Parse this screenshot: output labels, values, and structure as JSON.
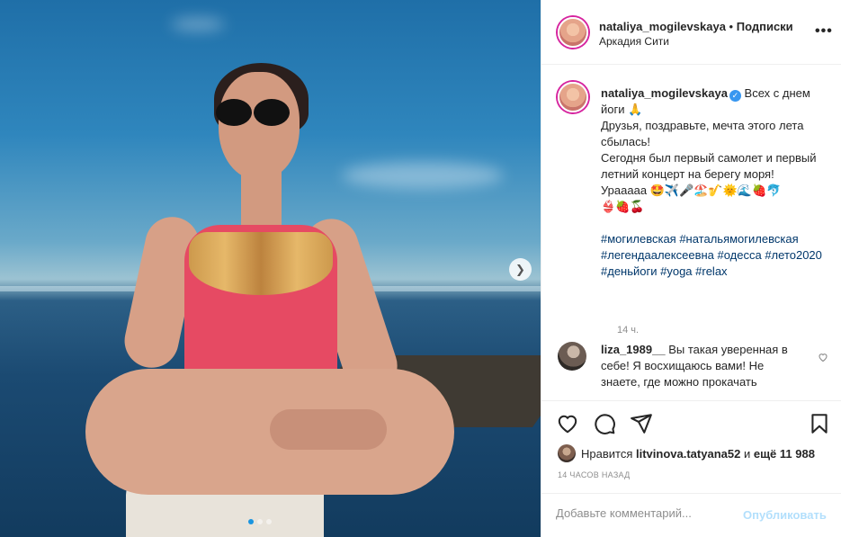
{
  "post": {
    "username": "nataliya_mogilevskaya",
    "separator": "•",
    "follow_label": "Подписки",
    "location": "Аркадия Сити",
    "more_icon": "more-options-icon"
  },
  "caption": {
    "username": "nataliya_mogilevskaya",
    "verified_mark": "✓",
    "line1": "Всех с днем йоги 🙏",
    "line2": "Друзья, поздравьте, мечта этого лета сбылась!",
    "line3": "Сегодня был первый самолет и первый летний концерт на берегу моря!",
    "line4": "Урааааа 🤩✈️🎤🏖️🎷🌞🌊🍓🐬",
    "line5": "👙🍓🍒",
    "hashtags": "#могилевская #натальямогилевская #легендаалексеевна #одесса #лето2020 #деньйоги #yoga #relax",
    "time": "14 ч."
  },
  "comment": {
    "username": "liza_1989__",
    "text": "Вы такая уверенная в себе! Я восхищаюсь вами! Не знаете, где можно прокачать"
  },
  "likes": {
    "prefix": "Нравится",
    "user": "litvinova.tatyana52",
    "conjunction": "и",
    "others": "ещё 11 988"
  },
  "time_ago": "14 ЧАСОВ НАЗАД",
  "add_comment": {
    "placeholder": "Добавьте комментарий...",
    "publish_label": "Опубликовать"
  },
  "colors": {
    "accent": "#3897f0",
    "publish_disabled": "#b2dffc",
    "hashtag": "#00376b"
  }
}
